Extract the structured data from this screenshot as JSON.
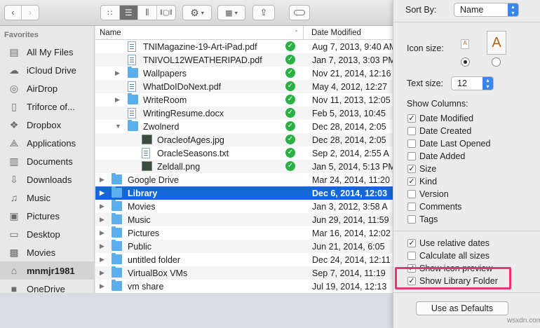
{
  "toolbar": {
    "back_icon": "chevron-left-icon",
    "forward_icon": "chevron-right-icon"
  },
  "sidebar": {
    "heading": "Favorites",
    "items": [
      {
        "label": "All My Files",
        "icon": "all-files-icon"
      },
      {
        "label": "iCloud Drive",
        "icon": "cloud-icon"
      },
      {
        "label": "AirDrop",
        "icon": "airdrop-icon"
      },
      {
        "label": "Triforce of...",
        "icon": "document-icon"
      },
      {
        "label": "Dropbox",
        "icon": "dropbox-icon"
      },
      {
        "label": "Applications",
        "icon": "applications-icon"
      },
      {
        "label": "Documents",
        "icon": "documents-icon"
      },
      {
        "label": "Downloads",
        "icon": "downloads-icon"
      },
      {
        "label": "Music",
        "icon": "music-icon"
      },
      {
        "label": "Pictures",
        "icon": "camera-icon"
      },
      {
        "label": "Desktop",
        "icon": "desktop-icon"
      },
      {
        "label": "Movies",
        "icon": "movies-icon"
      },
      {
        "label": "mnmjr1981",
        "icon": "home-icon"
      },
      {
        "label": "OneDrive",
        "icon": "folder-icon"
      }
    ]
  },
  "columns": {
    "name": "Name",
    "date": "Date Modified"
  },
  "files": [
    {
      "name": "TNIMagazine-19-Art-iPad.pdf",
      "date": "Aug 7, 2013, 9:40 AM",
      "type": "doc",
      "indent": 1,
      "synced": true
    },
    {
      "name": "TNIVOL12WEATHERIPAD.pdf",
      "date": "Jan 7, 2013, 3:03 PM",
      "type": "doc",
      "indent": 1,
      "synced": true
    },
    {
      "name": "Wallpapers",
      "date": "Nov 21, 2014, 12:16",
      "type": "folder",
      "indent": 1,
      "synced": true,
      "expand": "collapsed"
    },
    {
      "name": "WhatDoIDoNext.pdf",
      "date": "May 4, 2012, 12:27",
      "type": "doc",
      "indent": 1,
      "synced": true
    },
    {
      "name": "WriteRoom",
      "date": "Nov 11, 2013, 12:05",
      "type": "folder",
      "indent": 1,
      "synced": true,
      "expand": "collapsed"
    },
    {
      "name": "WritingResume.docx",
      "date": "Feb 5, 2013, 10:45",
      "type": "doc",
      "indent": 1,
      "synced": true
    },
    {
      "name": "Zwolnerd",
      "date": "Dec 28, 2014, 2:05",
      "type": "folder",
      "indent": 1,
      "synced": true,
      "expand": "expanded"
    },
    {
      "name": "OracleofAges.jpg",
      "date": "Dec 28, 2014, 2:05",
      "type": "img",
      "indent": 2,
      "synced": true
    },
    {
      "name": "OracleSeasons.txt",
      "date": "Sep 2, 2014, 2:55 A",
      "type": "doc",
      "indent": 2,
      "synced": true
    },
    {
      "name": "Zeldall.png",
      "date": "Jan 5, 2014, 5:13 PM",
      "type": "img",
      "indent": 2,
      "synced": true
    },
    {
      "name": "Google Drive",
      "date": "Mar 24, 2014, 11:20",
      "type": "folder",
      "indent": 0,
      "synced": false,
      "expand": "collapsed"
    },
    {
      "name": "Library",
      "date": "Dec 6, 2014, 12:03",
      "type": "folder",
      "indent": 0,
      "synced": false,
      "expand": "collapsed",
      "selected": true
    },
    {
      "name": "Movies",
      "date": "Jan 3, 2012, 3:58 A",
      "type": "folder",
      "indent": 0,
      "synced": false,
      "expand": "collapsed"
    },
    {
      "name": "Music",
      "date": "Jun 29, 2014, 11:59",
      "type": "folder",
      "indent": 0,
      "synced": false,
      "expand": "collapsed"
    },
    {
      "name": "Pictures",
      "date": "Mar 16, 2014, 12:02",
      "type": "folder",
      "indent": 0,
      "synced": false,
      "expand": "collapsed"
    },
    {
      "name": "Public",
      "date": "Jun 21, 2014, 6:05",
      "type": "folder",
      "indent": 0,
      "synced": false,
      "expand": "collapsed"
    },
    {
      "name": "untitled folder",
      "date": "Dec 24, 2014, 12:11",
      "type": "folder",
      "indent": 0,
      "synced": false,
      "expand": "collapsed"
    },
    {
      "name": "VirtualBox VMs",
      "date": "Sep 7, 2014, 11:19",
      "type": "folder",
      "indent": 0,
      "synced": false,
      "expand": "collapsed"
    },
    {
      "name": "vm share",
      "date": "Jul 19, 2014, 12:13",
      "type": "folder",
      "indent": 0,
      "synced": false,
      "expand": "collapsed"
    }
  ],
  "panel": {
    "sort_by_label": "Sort By:",
    "sort_by_value": "Name",
    "icon_size_label": "Icon size:",
    "text_size_label": "Text size:",
    "text_size_value": "12",
    "show_columns_label": "Show Columns:",
    "columns": [
      {
        "label": "Date Modified",
        "checked": true
      },
      {
        "label": "Date Created",
        "checked": false
      },
      {
        "label": "Date Last Opened",
        "checked": false
      },
      {
        "label": "Date Added",
        "checked": false
      },
      {
        "label": "Size",
        "checked": true
      },
      {
        "label": "Kind",
        "checked": true
      },
      {
        "label": "Version",
        "checked": false
      },
      {
        "label": "Comments",
        "checked": false
      },
      {
        "label": "Tags",
        "checked": false
      }
    ],
    "options": [
      {
        "label": "Use relative dates",
        "checked": true
      },
      {
        "label": "Calculate all sizes",
        "checked": false
      },
      {
        "label": "Show icon preview",
        "checked": true
      },
      {
        "label": "Show Library Folder",
        "checked": true
      }
    ],
    "defaults_button": "Use as Defaults"
  },
  "watermark": "wsxdn.com",
  "colors": {
    "selection": "#1566d6",
    "highlight": "#e8337a",
    "sync_check": "#2bb046"
  }
}
